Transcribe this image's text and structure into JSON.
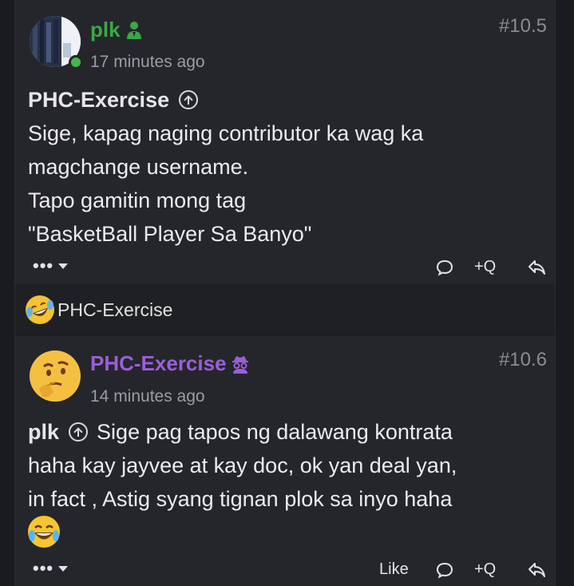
{
  "posts": [
    {
      "username": "plk",
      "role_icon": "staff-user-icon",
      "timestamp": "17 minutes ago",
      "post_number": "#10.5",
      "online": true,
      "quote_author": "PHC-Exercise",
      "lines": [
        "Sige, kapag naging contributor ka wag ka",
        "magchange username.",
        "Tapo gamitin mong tag",
        "\"BasketBall Player Sa Banyo\""
      ],
      "actions": {
        "more": "•••",
        "reply": "",
        "quote": "+Q",
        "share": ""
      }
    },
    {
      "username": "PHC-Exercise",
      "role_icon": "incognito-icon",
      "timestamp": "14 minutes ago",
      "post_number": "#10.6",
      "quote_author": "plk",
      "lines": [
        "Sige pag tapos ng dalawang kontrata",
        "haha kay jayvee at kay doc, ok yan deal yan,",
        "in fact , Astig syang tignan plok sa inyo haha"
      ],
      "emoji": "laughing-tears-emoji",
      "actions": {
        "more": "•••",
        "like": "Like",
        "reply": "",
        "quote": "+Q",
        "share": ""
      }
    }
  ],
  "reactions": {
    "emoji": "rofl-emoji",
    "users": "PHC-Exercise"
  },
  "colors": {
    "background": "#1e1f23",
    "post_bg": "#25262b",
    "username_green": "#3aa845",
    "username_purple": "#9c5ed8",
    "online": "#45b649",
    "muted": "#9a9ca3"
  }
}
